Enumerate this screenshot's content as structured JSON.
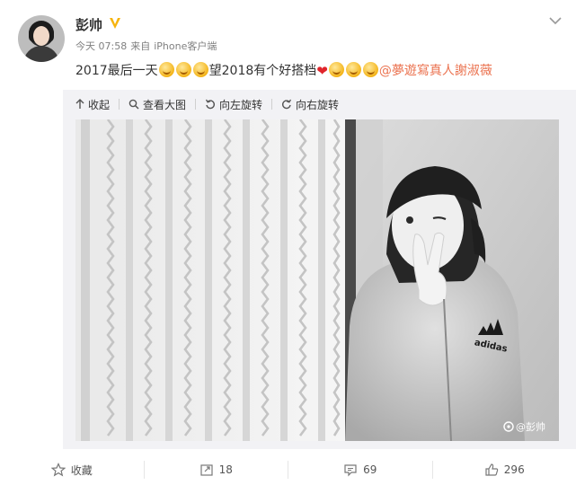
{
  "post": {
    "author": "彭帅",
    "meta_time": "今天 07:58",
    "meta_from": "来自",
    "meta_source": "iPhone客户端",
    "text_part1": "2017最后一天",
    "text_part2": "望2018有个好搭档",
    "mention": "@夢遊寫真人謝淑薇"
  },
  "toolbar": {
    "collapse": "收起",
    "view_large": "查看大图",
    "rotate_left": "向左旋转",
    "rotate_right": "向右旋转"
  },
  "photo": {
    "watermark": "@彭帅"
  },
  "footer": {
    "favorite": "收藏",
    "repost_count": "18",
    "comment_count": "69",
    "like_count": "296"
  },
  "colors": {
    "mention": "#eb7350",
    "badge": "#f6b40e",
    "media_bg": "#f2f2f5"
  },
  "icons": [
    "avatar",
    "verified-badge-icon",
    "chevron-down-icon",
    "arrow-up-icon",
    "magnifier-icon",
    "rotate-left-icon",
    "rotate-right-icon",
    "star-icon",
    "repost-icon",
    "comment-icon",
    "thumb-up-icon"
  ]
}
